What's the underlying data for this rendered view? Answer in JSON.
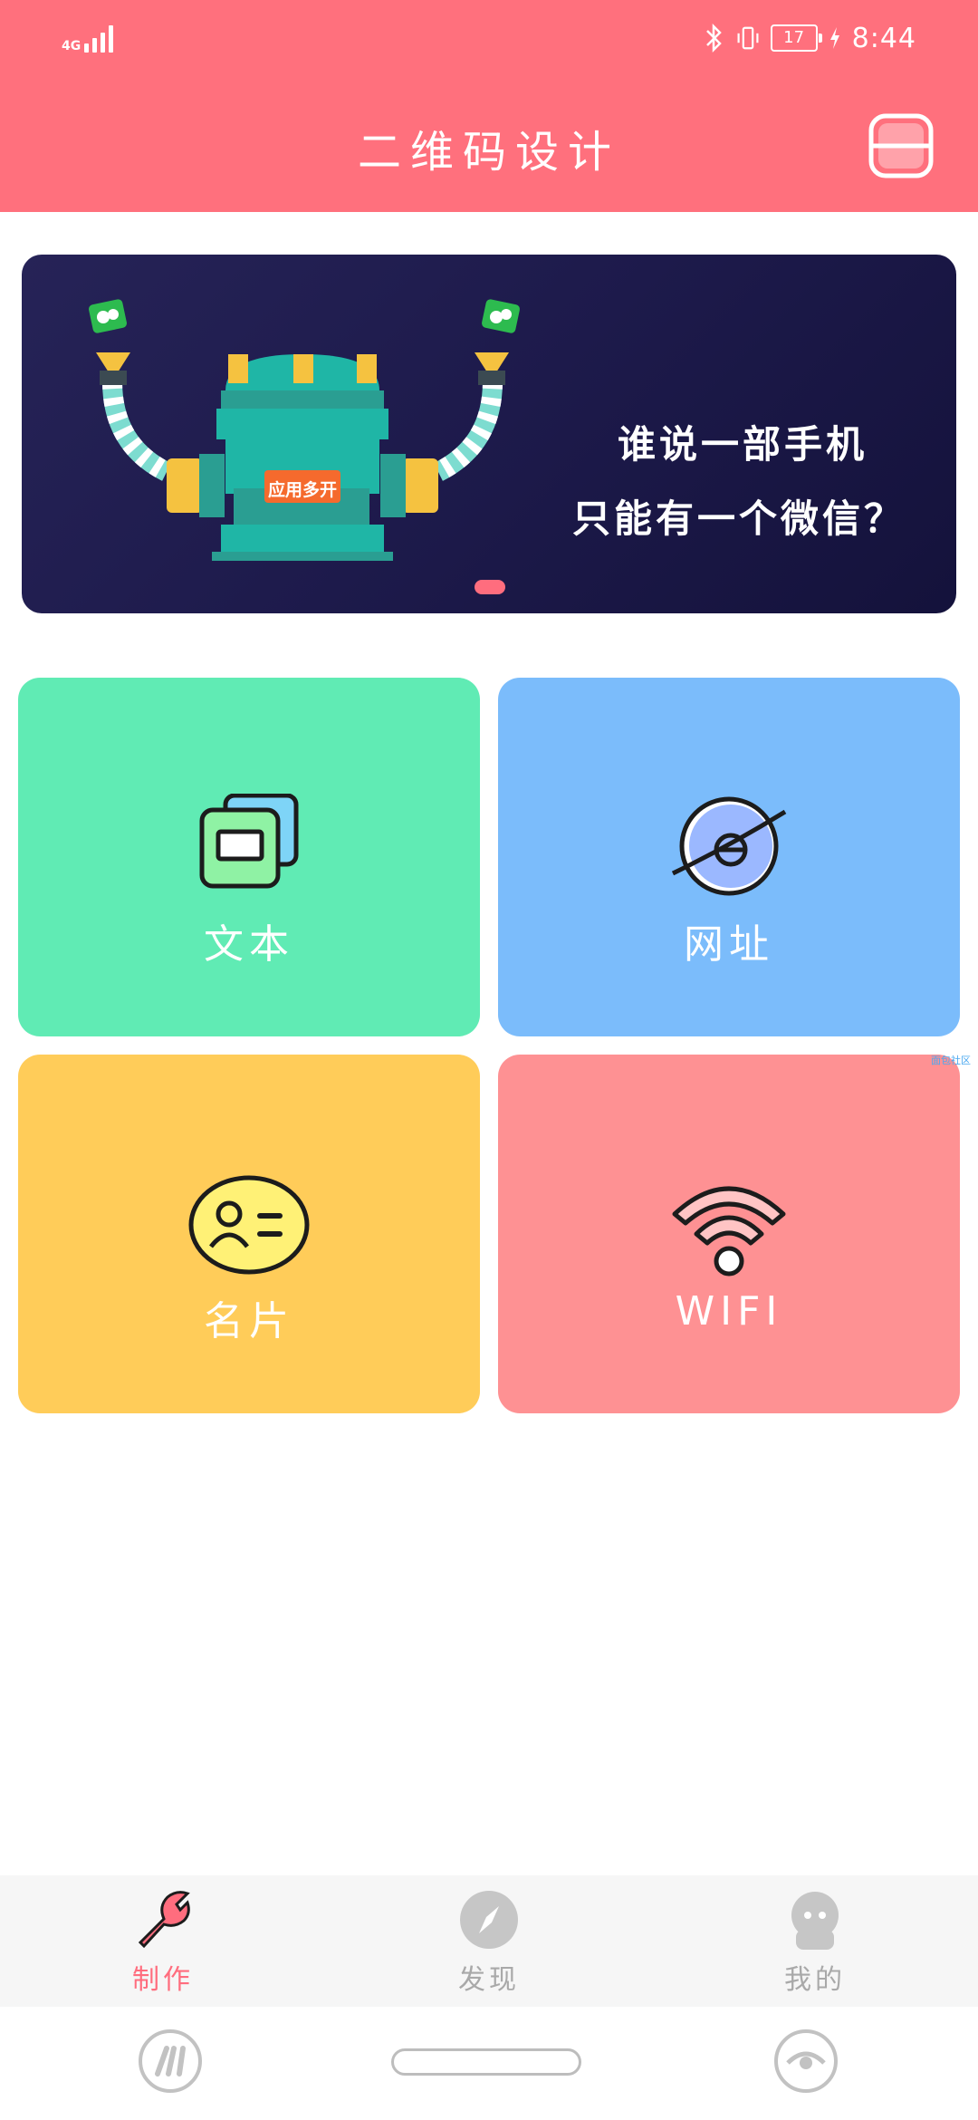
{
  "status_bar": {
    "network": "4G",
    "battery": "17",
    "time": "8:44",
    "icons": [
      "signal-icon",
      "bluetooth-icon",
      "vibrate-icon",
      "battery-icon",
      "charging-icon"
    ]
  },
  "header": {
    "title": "二维码设计",
    "scan_icon": "scan-icon",
    "background": "#ff707d"
  },
  "banner": {
    "line1": "谁说一部手机",
    "line2": "只能有一个微信？",
    "robot_label": "应用多开",
    "active_page": 1,
    "page_count": 1
  },
  "tiles": [
    {
      "label": "文本",
      "icon": "text-icon",
      "color": "#60ebb4"
    },
    {
      "label": "网址",
      "icon": "globe-icon",
      "color": "#7bbcfb"
    },
    {
      "label": "名片",
      "icon": "contact-card-icon",
      "color": "#ffcc59"
    },
    {
      "label": "WIFI",
      "icon": "wifi-icon",
      "color": "#fe9193"
    }
  ],
  "watermark": "面包社区",
  "tabbar": {
    "items": [
      {
        "label": "制作",
        "icon": "wrench-icon",
        "active": true
      },
      {
        "label": "发现",
        "icon": "compass-icon",
        "active": false
      },
      {
        "label": "我的",
        "icon": "user-icon",
        "active": false
      }
    ],
    "active_color": "#ff6d7e",
    "inactive_color": "#a9a9a9"
  },
  "system_nav": [
    "app-switch-icon",
    "home-pill",
    "eye-icon"
  ]
}
